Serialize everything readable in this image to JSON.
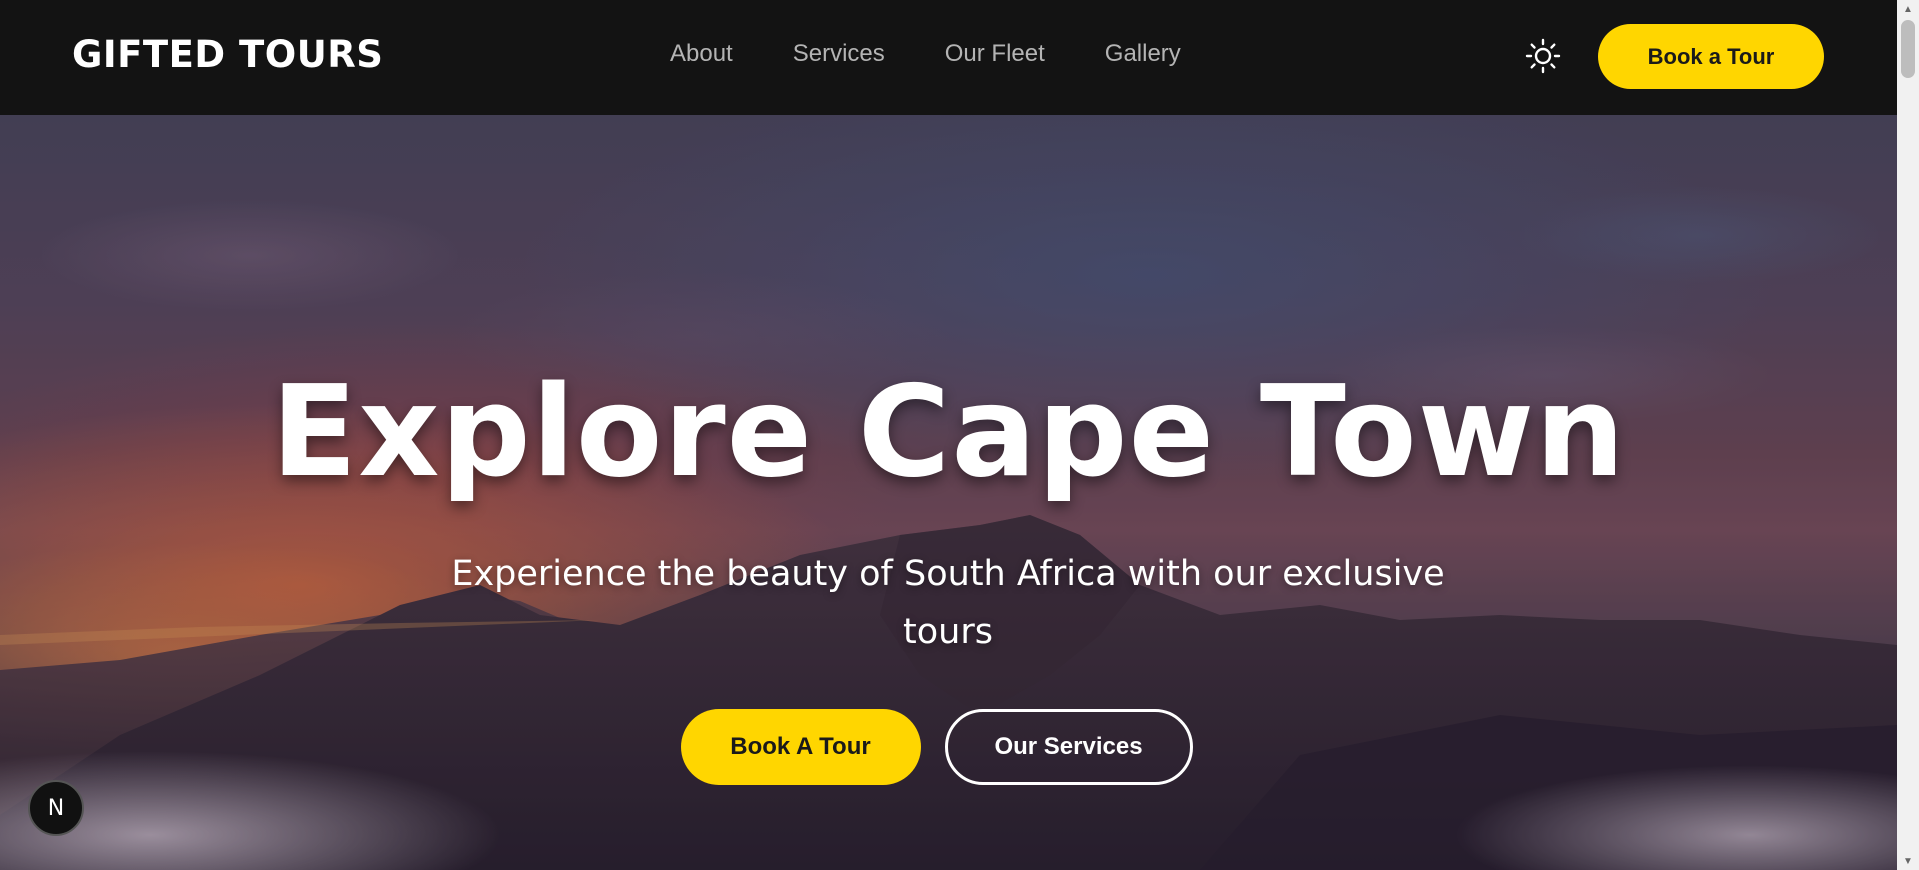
{
  "header": {
    "logo": "GIFTED TOURS",
    "nav": [
      "About",
      "Services",
      "Our Fleet",
      "Gallery"
    ],
    "theme_icon": "sun-icon",
    "book_label": "Book a Tour"
  },
  "hero": {
    "title": "Explore Cape Town",
    "subtitle": "Experience the beauty of South Africa with our exclusive tours",
    "primary_button": "Book A Tour",
    "secondary_button": "Our Services"
  },
  "dev_badge": {
    "letter": "N"
  },
  "colors": {
    "accent": "#ffd600",
    "header_bg": "#131313",
    "nav_text": "#b4b4b4"
  }
}
